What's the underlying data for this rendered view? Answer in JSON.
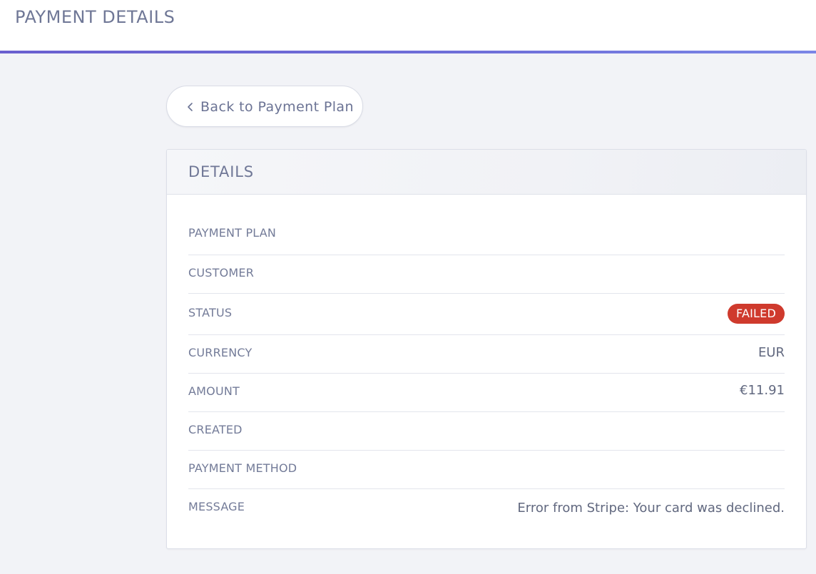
{
  "header": {
    "title": "PAYMENT DETAILS"
  },
  "back_button": {
    "label": "Back to Payment Plan",
    "icon": "chevron-left-icon"
  },
  "card": {
    "title": "DETAILS",
    "rows": [
      {
        "label": "PAYMENT PLAN",
        "value": ""
      },
      {
        "label": "CUSTOMER",
        "value": ""
      },
      {
        "label": "STATUS",
        "value": "FAILED"
      },
      {
        "label": "CURRENCY",
        "value": "EUR"
      },
      {
        "label": "AMOUNT",
        "value": "€11.91"
      },
      {
        "label": "CREATED",
        "value": ""
      },
      {
        "label": "PAYMENT METHOD",
        "value": ""
      },
      {
        "label": "MESSAGE",
        "value": "Error from Stripe: Your card was declined."
      }
    ]
  },
  "colors": {
    "accent": "#6a5fcf",
    "status_failed": "#cf3a2d",
    "background": "#f2f3f7"
  }
}
